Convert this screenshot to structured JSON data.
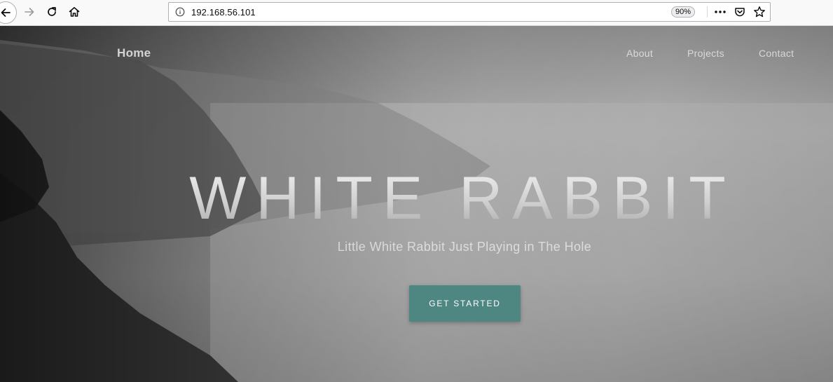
{
  "browser": {
    "url": "192.168.56.101",
    "zoom": "90%",
    "icons": {
      "back": "back-arrow-icon",
      "forward": "forward-arrow-icon",
      "reload": "reload-icon",
      "home": "home-icon",
      "info": "info-icon",
      "more": "more-dots-icon",
      "pocket": "pocket-icon",
      "bookmark": "star-icon"
    }
  },
  "site": {
    "nav": {
      "home": "Home",
      "about": "About",
      "projects": "Projects",
      "contact": "Contact"
    },
    "hero": {
      "title": "WHITE RABBIT",
      "subtitle": "Little White Rabbit Just Playing in The Hole",
      "cta": "GET STARTED"
    },
    "colors": {
      "cta_background": "#4e8682",
      "cta_text": "#ffffff"
    }
  }
}
